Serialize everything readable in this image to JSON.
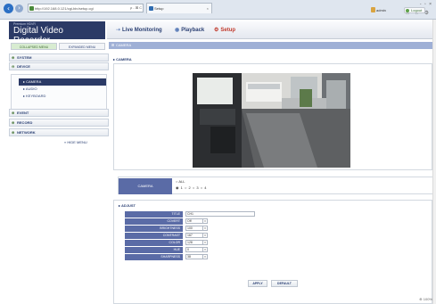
{
  "browser": {
    "back_icon": "back-arrow-icon",
    "forward_icon": "forward-arrow-icon",
    "address": "http://192.168.0.121/cgi-bin/setup.cgi",
    "address_tools": "ρ - ⊠ C",
    "tab_title": "Setup",
    "tab_close": "×",
    "window_controls": "- ▫ ×",
    "toolbar_icons": "⌂ ☆ ⚙"
  },
  "header": {
    "brand": "Premium HDVR",
    "title": "Digital Video Recorder",
    "nav": [
      {
        "icon": "➝",
        "label": "Live Monitoring"
      },
      {
        "icon": "◉",
        "label": "Playback"
      },
      {
        "icon": "⚙",
        "label": "Setup"
      }
    ],
    "user": "admin",
    "logout": "Logout"
  },
  "sidebar": {
    "tabs": {
      "collapsed": "COLLAPSED MENU",
      "expanded": "EXPANDED MENU"
    },
    "sections": [
      {
        "label": "SYSTEM"
      },
      {
        "label": "DEVICE"
      },
      {
        "label": "EVENT"
      },
      {
        "label": "RECORD"
      },
      {
        "label": "NETWORK"
      }
    ],
    "device_items": [
      "CAMERA",
      "AUDIO",
      "KEYBOARD"
    ],
    "hide_menu": "HIDE MENU"
  },
  "main": {
    "breadcrumb": "CAMERA",
    "section_title": "CAMERA",
    "camera_select": {
      "label": "CAMERA",
      "all": "ALL",
      "options": [
        "1",
        "2",
        "3",
        "4"
      ],
      "selected": "1"
    },
    "adjust": {
      "title": "ADJUST",
      "fields": [
        {
          "label": "TITLE",
          "value": "CH1",
          "type": "text"
        },
        {
          "label": "COVERT",
          "value": "Off",
          "type": "select"
        },
        {
          "label": "BRIGHTNESS",
          "value": "100",
          "type": "select"
        },
        {
          "label": "CONTRAST",
          "value": "167",
          "type": "select"
        },
        {
          "label": "COLOR",
          "value": "128",
          "type": "select"
        },
        {
          "label": "HUE",
          "value": "0",
          "type": "select"
        },
        {
          "label": "SHARPNESS",
          "value": "38",
          "type": "select"
        }
      ],
      "apply": "APPLY",
      "default": "DEFAULT"
    }
  },
  "status": {
    "zoom": "100%"
  }
}
